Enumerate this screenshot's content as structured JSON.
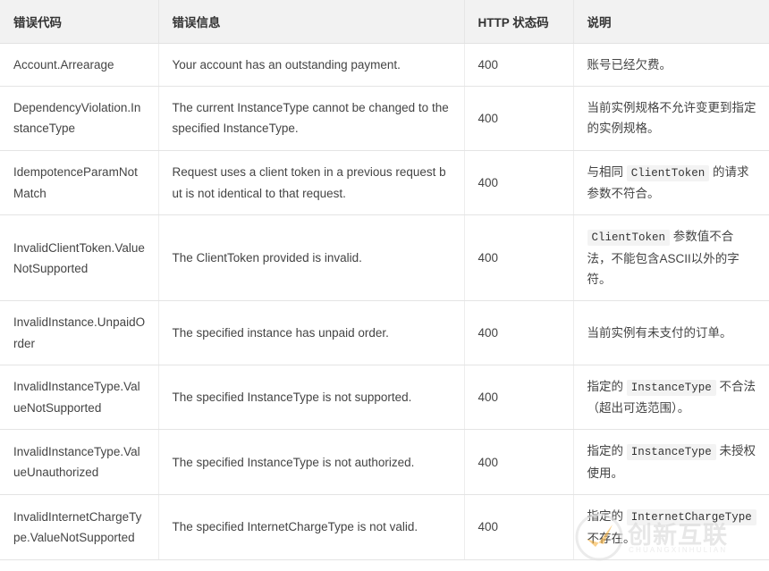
{
  "table": {
    "columns": [
      {
        "key": "code",
        "label": "错误代码"
      },
      {
        "key": "message",
        "label": "错误信息"
      },
      {
        "key": "http",
        "label": "HTTP 状态码"
      },
      {
        "key": "desc",
        "label": "说明"
      }
    ],
    "rows": [
      {
        "code": "Account.Arrearage",
        "message": "Your account has an outstanding payment.",
        "http": "400",
        "desc_parts": [
          {
            "type": "text",
            "value": "账号已经欠费。"
          }
        ]
      },
      {
        "code": "DependencyViolation.InstanceType",
        "message": "The current InstanceType cannot be changed to the specified InstanceType.",
        "http": "400",
        "desc_parts": [
          {
            "type": "text",
            "value": "当前实例规格不允许变更到指定的实例规格。"
          }
        ]
      },
      {
        "code": "IdempotenceParamNotMatch",
        "message": "Request uses a client token in a previous request but is not identical to that request.",
        "http": "400",
        "desc_parts": [
          {
            "type": "text",
            "value": "与相同"
          },
          {
            "type": "code",
            "value": "ClientToken"
          },
          {
            "type": "text",
            "value": "的请求参数不符合。"
          }
        ]
      },
      {
        "code": "InvalidClientToken.ValueNotSupported",
        "message": "The ClientToken provided is invalid.",
        "http": "400",
        "desc_parts": [
          {
            "type": "code",
            "value": "ClientToken"
          },
          {
            "type": "text",
            "value": "参数值不合法，不能包含ASCII以外的字符。"
          }
        ]
      },
      {
        "code": "InvalidInstance.UnpaidOrder",
        "message": "The specified instance has unpaid order.",
        "http": "400",
        "desc_parts": [
          {
            "type": "text",
            "value": "当前实例有未支付的订单。"
          }
        ]
      },
      {
        "code": "InvalidInstanceType.ValueNotSupported",
        "message": "The specified InstanceType is not supported.",
        "http": "400",
        "desc_parts": [
          {
            "type": "text",
            "value": "指定的"
          },
          {
            "type": "code",
            "value": "InstanceType"
          },
          {
            "type": "text",
            "value": "不合法（超出可选范围）。"
          }
        ]
      },
      {
        "code": "InvalidInstanceType.ValueUnauthorized",
        "message": "The specified InstanceType is not authorized.",
        "http": "400",
        "desc_parts": [
          {
            "type": "text",
            "value": "指定的"
          },
          {
            "type": "code",
            "value": "InstanceType"
          },
          {
            "type": "text",
            "value": "未授权使用。"
          }
        ]
      },
      {
        "code": "InvalidInternetChargeType.ValueNotSupported",
        "message": "The specified InternetChargeType is not valid.",
        "http": "400",
        "desc_parts": [
          {
            "type": "text",
            "value": "指定的"
          },
          {
            "type": "code",
            "value": "InternetChargeType"
          },
          {
            "type": "text",
            "value": "不存在。"
          }
        ]
      }
    ]
  },
  "watermark": {
    "text": "创新互联",
    "subtext": "CHUANGXINHULIAN"
  },
  "colors": {
    "header_bg": "#f2f2f2",
    "border": "#e4e4e4",
    "text": "#444444",
    "code_bg": "#f3f3f3",
    "watermark_accent": "#f5a623"
  }
}
